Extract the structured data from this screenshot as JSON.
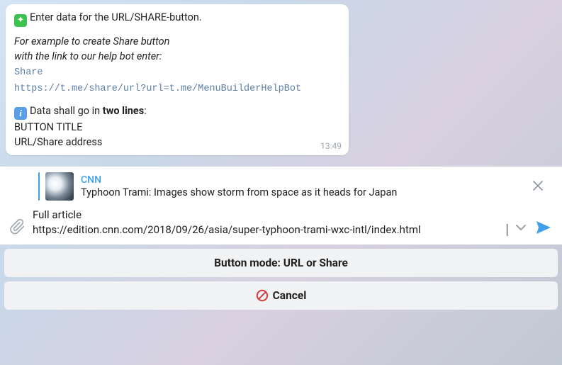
{
  "message": {
    "line1": "Enter data for the URL/SHARE-button.",
    "example_intro1": "For example to create Share button",
    "example_intro2": "with the link to our help bot enter:",
    "mono1": "Share",
    "mono2": "https://t.me/share/url?url=t.me/MenuBuilderHelpBot",
    "two_lines_pre": "Data shall go in ",
    "two_lines_bold": "two lines",
    "two_lines_post": ":",
    "line_btn_title": "BUTTON TITLE",
    "line_url": "URL/Share address",
    "time": "13:49"
  },
  "reply": {
    "source": "CNN",
    "title": "Typhoon Trami: Images show storm from space as it heads for Japan"
  },
  "compose": {
    "text": "Full article\nhttps://edition.cnn.com/2018/09/26/asia/super-typhoon-trami-wxc-intl/index.html"
  },
  "buttons": {
    "mode": "Button mode: URL or Share",
    "cancel": "Cancel"
  }
}
